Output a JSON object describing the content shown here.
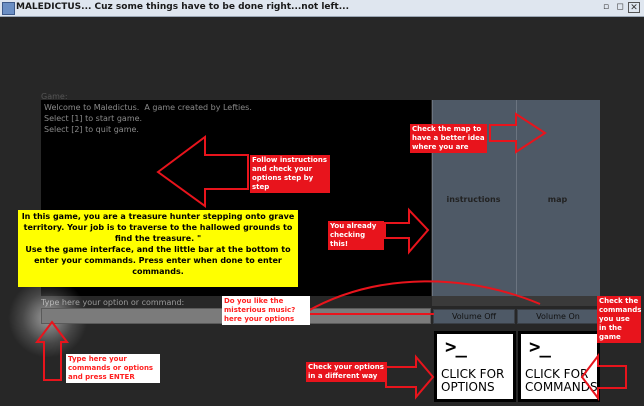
{
  "window": {
    "title": "MALEDICTUS... Cuz some things have to be done right...not left..."
  },
  "game": {
    "label": "Game:",
    "console_lines": [
      "Welcome to Maledictus.  A game created by Lefties.",
      "",
      "Select [1] to start game.",
      "Select [2] to quit game."
    ]
  },
  "panels": {
    "instructions_label": "instructions",
    "map_label": "map"
  },
  "command": {
    "label": "Type here your option or command:",
    "value": ""
  },
  "volume": {
    "off_label": "Volume Off",
    "on_label": "Volume On"
  },
  "buttons": {
    "options": {
      "prompt": ">_",
      "line1": "CLICK FOR",
      "line2": "OPTIONS"
    },
    "commands": {
      "prompt": ">_",
      "line1": "CLICK FOR",
      "line2": "COMMANDS"
    }
  },
  "annotations": {
    "follow": "Follow instructions and check your options step by step",
    "map": "Check the map to have a better idea where you are",
    "checking": "You already checking this!",
    "music": "Do you like the misterious music? here your options",
    "commands_note": "Check the commands you use in the game",
    "type_here": "Type here your commands or options and press ENTER",
    "options_note": "Check your options in a different way",
    "intro": "In this game, you are a treasure hunter stepping onto grave territory. Your job is to traverse to the hallowed grounds to find the treasure. \"\nUse the game interface, and the little bar at the bottom to enter your commands. Press enter when done to enter commands."
  },
  "colors": {
    "annotation_red": "#e8141c",
    "intro_yellow": "#ffff00",
    "panel": "#4e5966"
  }
}
